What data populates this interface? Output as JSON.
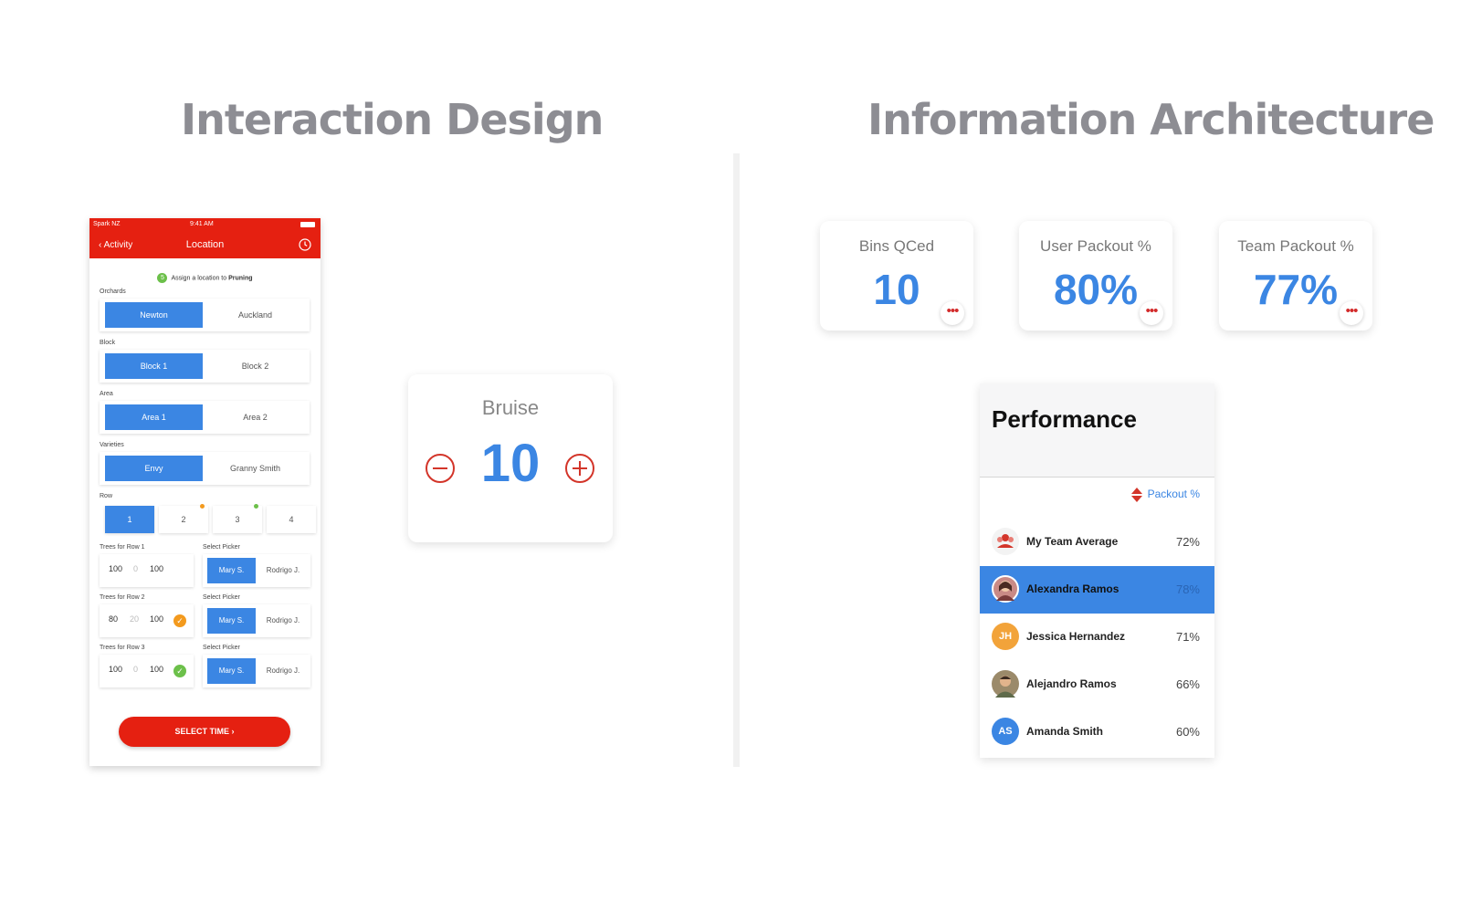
{
  "titles": {
    "left": "Interaction Design",
    "right": "Information Architecture"
  },
  "phone": {
    "status": {
      "carrier": "Spark NZ",
      "time": "9:41 AM"
    },
    "nav": {
      "back_label": "Activity",
      "title": "Location"
    },
    "assign": {
      "step": "5",
      "text_prefix": "Assign a location to ",
      "text_bold": "Pruning"
    },
    "orchards": {
      "label": "Orchards",
      "options": [
        "Newton",
        "Auckland"
      ],
      "selected": "Newton"
    },
    "block": {
      "label": "Block",
      "options": [
        "Block 1",
        "Block 2"
      ],
      "selected": "Block 1"
    },
    "area": {
      "label": "Area",
      "options": [
        "Area 1",
        "Area 2"
      ],
      "selected": "Area 1"
    },
    "varieties": {
      "label": "Varieties",
      "options": [
        "Envy",
        "Granny Smith"
      ],
      "selected": "Envy"
    },
    "row": {
      "label": "Row",
      "options": [
        "1",
        "2",
        "3",
        "4"
      ],
      "selected": "1"
    },
    "trees": [
      {
        "label": "Trees for Row 1",
        "picker_label": "Select Picker",
        "done": "100",
        "remaining": "0",
        "total": "100",
        "status": "",
        "pickers": [
          "Mary S.",
          "Rodrigo J."
        ]
      },
      {
        "label": "Trees for Row 2",
        "picker_label": "Select Picker",
        "done": "80",
        "remaining": "20",
        "total": "100",
        "status": "partial",
        "pickers": [
          "Mary S.",
          "Rodrigo J."
        ]
      },
      {
        "label": "Trees for Row 3",
        "picker_label": "Select Picker",
        "done": "100",
        "remaining": "0",
        "total": "100",
        "status": "complete",
        "pickers": [
          "Mary S.",
          "Rodrigo J."
        ]
      }
    ],
    "select_time_label": "SELECT TIME"
  },
  "bruise": {
    "label": "Bruise",
    "value": "10"
  },
  "kpis": [
    {
      "label": "Bins QCed",
      "value": "10"
    },
    {
      "label": "User Packout %",
      "value": "80%"
    },
    {
      "label": "Team Packout %",
      "value": "77%"
    }
  ],
  "performance": {
    "title": "Performance",
    "sort_label": "Packout %",
    "rows": [
      {
        "name": "My Team Average",
        "value": "72%",
        "avatar": "team-icon",
        "initials": ""
      },
      {
        "name": "Alexandra Ramos",
        "value": "78%",
        "avatar": "photo",
        "initials": ""
      },
      {
        "name": "Jessica Hernandez",
        "value": "71%",
        "avatar": "initials",
        "initials": "JH"
      },
      {
        "name": "Alejandro Ramos",
        "value": "66%",
        "avatar": "photo",
        "initials": ""
      },
      {
        "name": "Amanda Smith",
        "value": "60%",
        "avatar": "initials",
        "initials": "AS"
      }
    ]
  },
  "colors": {
    "brand_red": "#e52011",
    "accent_blue": "#3b86e3",
    "title_gray": "#8d8d93",
    "partial_orange": "#f39a1e",
    "complete_green": "#6cc04a"
  }
}
